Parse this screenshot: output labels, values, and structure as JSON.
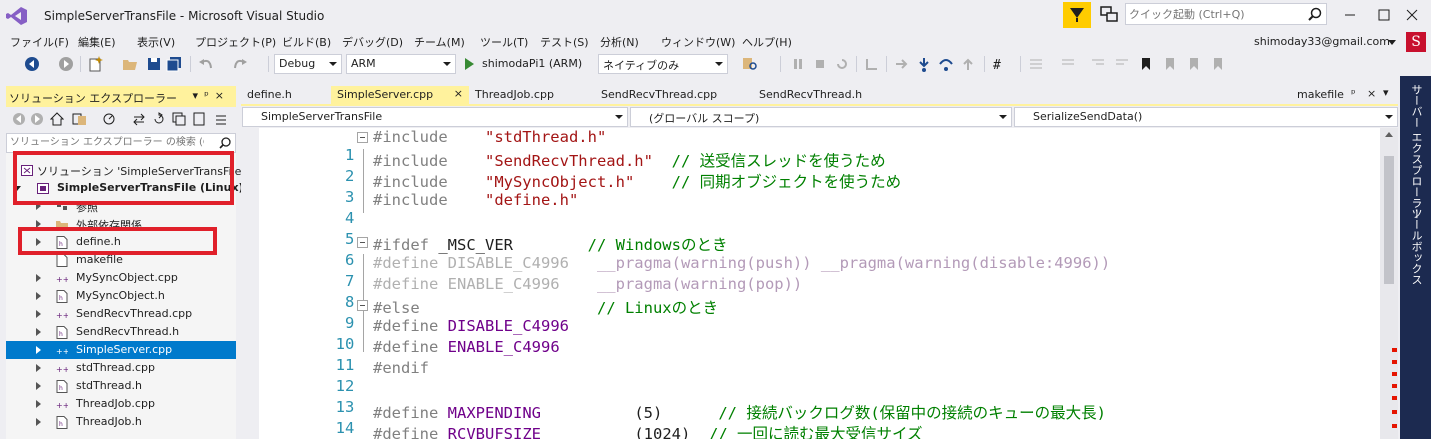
{
  "window": {
    "title": "SimpleServerTransFile - Microsoft Visual Studio",
    "quick_launch_placeholder": "クイック起動 (Ctrl+Q)",
    "account": "shimoday33@gmail.com",
    "avatar_letter": "S"
  },
  "menu": [
    "ファイル(F)",
    "編集(E)",
    "表示(V)",
    "プロジェクト(P)",
    "ビルド(B)",
    "デバッグ(D)",
    "チーム(M)",
    "ツール(T)",
    "テスト(S)",
    "分析(N)",
    "ウィンドウ(W)",
    "ヘルプ(H)"
  ],
  "toolbar": {
    "config": "Debug",
    "platform": "ARM",
    "run_target": "shimodaPi1 (ARM)",
    "debugger_mode": "ネイティブのみ"
  },
  "solution_explorer": {
    "title": "ソリューション エクスプローラー",
    "search_placeholder": "ソリューション エクスプローラー の検索 (Ct",
    "items": [
      {
        "label": "ソリューション 'SimpleServerTransFile' (",
        "icon": "solution-icon"
      },
      {
        "label": "SimpleServerTransFile (Linux)",
        "icon": "project-icon"
      },
      {
        "label": "参照",
        "icon": "references-icon"
      },
      {
        "label": "外部依存関係",
        "icon": "folder-icon"
      },
      {
        "label": "define.h",
        "icon": "header-file-icon"
      },
      {
        "label": "makefile",
        "icon": "file-icon"
      },
      {
        "label": "MySyncObject.cpp",
        "icon": "cpp-file-icon"
      },
      {
        "label": "MySyncObject.h",
        "icon": "header-file-icon"
      },
      {
        "label": "SendRecvThread.cpp",
        "icon": "cpp-file-icon"
      },
      {
        "label": "SendRecvThread.h",
        "icon": "header-file-icon"
      },
      {
        "label": "SimpleServer.cpp",
        "icon": "cpp-file-icon"
      },
      {
        "label": "stdThread.cpp",
        "icon": "cpp-file-icon"
      },
      {
        "label": "stdThread.h",
        "icon": "header-file-icon"
      },
      {
        "label": "ThreadJob.cpp",
        "icon": "cpp-file-icon"
      },
      {
        "label": "ThreadJob.h",
        "icon": "header-file-icon"
      }
    ]
  },
  "tabs": [
    "define.h",
    "SimpleServer.cpp",
    "ThreadJob.cpp",
    "SendRecvThread.cpp",
    "SendRecvThread.h",
    "makefile"
  ],
  "nav": {
    "project": "SimpleServerTransFile",
    "scope": "(グローバル スコープ)",
    "member": "SerializeSendData()"
  },
  "code_lines": [
    {
      "n": "1",
      "t": [
        "#include",
        "\"stdThread.h\"",
        ""
      ]
    },
    {
      "n": "2",
      "t": [
        "#include",
        "\"SendRecvThread.h\"",
        "// 送受信スレッドを使うため"
      ]
    },
    {
      "n": "3",
      "t": [
        "#include",
        "\"MySyncObject.h\"",
        "// 同期オブジェクトを使うため"
      ]
    },
    {
      "n": "4",
      "t": [
        "#include",
        "\"define.h\"",
        ""
      ]
    },
    {
      "n": "5",
      "t": [
        "",
        "",
        ""
      ]
    },
    {
      "n": "6",
      "t": [
        "#ifdef",
        "_MSC_VER",
        "// Windowsのとき"
      ]
    },
    {
      "n": "7",
      "t": [
        "#define DISABLE_C4996",
        "__pragma(warning(push)) __pragma(warning(disable:4996))",
        ""
      ]
    },
    {
      "n": "8",
      "t": [
        "#define ENABLE_C4996",
        "__pragma(warning(pop))",
        ""
      ]
    },
    {
      "n": "9",
      "t": [
        "#else",
        "",
        "// Linuxのとき"
      ]
    },
    {
      "n": "10",
      "t": [
        "#define",
        "DISABLE_C4996",
        ""
      ]
    },
    {
      "n": "11",
      "t": [
        "#define",
        "ENABLE_C4996",
        ""
      ]
    },
    {
      "n": "12",
      "t": [
        "#endif",
        "",
        ""
      ]
    },
    {
      "n": "13",
      "t": [
        "",
        "",
        ""
      ]
    },
    {
      "n": "14",
      "t": [
        "#define",
        "MAXPENDING",
        "(5)",
        "// 接続バックログ数(保留中の接続のキューの最大長)"
      ]
    },
    {
      "n": "15",
      "t": [
        "#define",
        "RCVBUFSIZE",
        "(1024)",
        "// 一回に読む最大受信サイズ"
      ]
    }
  ],
  "side_panels": [
    "サーバー エクスプローラー",
    "ツールボックス"
  ],
  "colors": {
    "accent_yellow": "#fff29d",
    "selection_blue": "#007acc",
    "highlight_red": "#e0202a",
    "side_panel": "#1c2a50"
  }
}
